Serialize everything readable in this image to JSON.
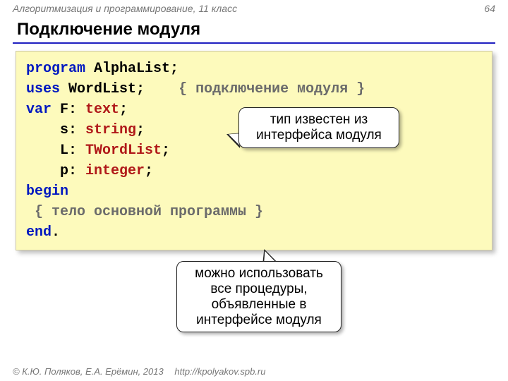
{
  "header": {
    "course": "Алгоритмизация и программирование, 11 класс",
    "page": "64"
  },
  "title": "Подключение модуля",
  "code": {
    "l1_kw1": "program",
    "l1_name": " AlphaList",
    "semi": ";",
    "l2_kw": "uses",
    "l2_name": " WordList",
    "l2_comment": "{ подключение модуля }",
    "l3_kw": "var",
    "l3_a": " F: ",
    "l3_typ": "text",
    "l4_a": "    s: ",
    "l4_typ": "string",
    "l5_a": "    L: ",
    "l5_typ": "TWordList",
    "l6_a": "    p: ",
    "l6_typ": "integer",
    "l7_kw": "begin",
    "l8_comment": " { тело основной программы }",
    "l9_kw": "end",
    "dot": "."
  },
  "callouts": {
    "c1": "тип известен из интерфейса модуля",
    "c2": "можно использовать все процедуры, объявленные в интерфейсе модуля"
  },
  "footer": {
    "copyright": "© К.Ю. Поляков, Е.А. Ерёмин, 2013",
    "url": "http://kpolyakov.spb.ru"
  }
}
